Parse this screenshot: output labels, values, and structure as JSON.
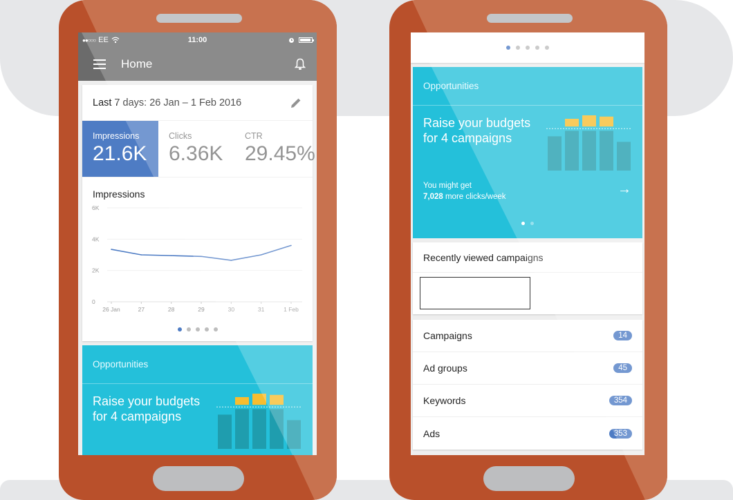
{
  "colors": {
    "phone_body": "#b9502b",
    "phone_glare": "#c8724f",
    "app_bar": "#6b6b6b",
    "accent_blue": "#4e7cc4",
    "opportunity_cyan": "#24c0da",
    "illus_yellow": "#f7bd2f",
    "illus_teal": "#1e97a6"
  },
  "left_phone": {
    "status_bar": {
      "signal": "●●○○○",
      "carrier": "EE",
      "wifi_icon": "wifi-icon",
      "time": "11:00",
      "alarm_icon": "alarm-icon",
      "battery_icon": "battery-icon"
    },
    "app_bar": {
      "menu_icon": "≡",
      "title": "Home",
      "bell_icon": "🔔"
    },
    "date_range": {
      "label": "Last 7 days: 26 Jan – 1 Feb 2016",
      "edit_icon": "✎"
    },
    "metrics": [
      {
        "label": "Impressions",
        "value": "21.6K",
        "active": true
      },
      {
        "label": "Clicks",
        "value": "6.36K",
        "active": false
      },
      {
        "label": "CTR",
        "value": "29.45%",
        "active": false
      }
    ],
    "chart_title": "Impressions",
    "pager_dots": {
      "count": 5,
      "active": 0
    },
    "opportunity": {
      "header": "Opportunities",
      "title": "Raise your budgets for 4 campaigns"
    }
  },
  "right_phone": {
    "pager_dots": {
      "count": 5,
      "active": 0
    },
    "opportunity": {
      "header": "Opportunities",
      "title": "Raise your budgets for 4 campaigns",
      "sub_line1": "You might get",
      "sub_bold": "7,028",
      "sub_line2_rest": " more clicks/week",
      "arrow_icon": "→",
      "dots": {
        "count": 2,
        "active": 0
      }
    },
    "recent": {
      "title": "Recently viewed campaigns"
    },
    "list": [
      {
        "label": "Campaigns",
        "count": "14"
      },
      {
        "label": "Ad groups",
        "count": "45"
      },
      {
        "label": "Keywords",
        "count": "354"
      },
      {
        "label": "Ads",
        "count": "353"
      }
    ]
  },
  "chart_data": {
    "type": "line",
    "title": "Impressions",
    "x": [
      "26 Jan",
      "27",
      "28",
      "29",
      "30",
      "31",
      "1 Feb"
    ],
    "series": [
      {
        "name": "Impressions",
        "values": [
          3350,
          3000,
          2950,
          2900,
          2650,
          3000,
          3600
        ]
      }
    ],
    "yticks": [
      "0",
      "2K",
      "4K",
      "6K"
    ],
    "ytick_values": [
      0,
      2000,
      4000,
      6000
    ],
    "ylim": [
      0,
      6000
    ],
    "grid": true,
    "xlabel": "",
    "ylabel": ""
  },
  "illustration": {
    "base_bars": [
      0.62,
      0.72,
      0.72,
      0.72,
      0.52
    ],
    "increase_bars": [
      0,
      0.14,
      0.3,
      0.18,
      0
    ],
    "target_line": 0.76
  }
}
